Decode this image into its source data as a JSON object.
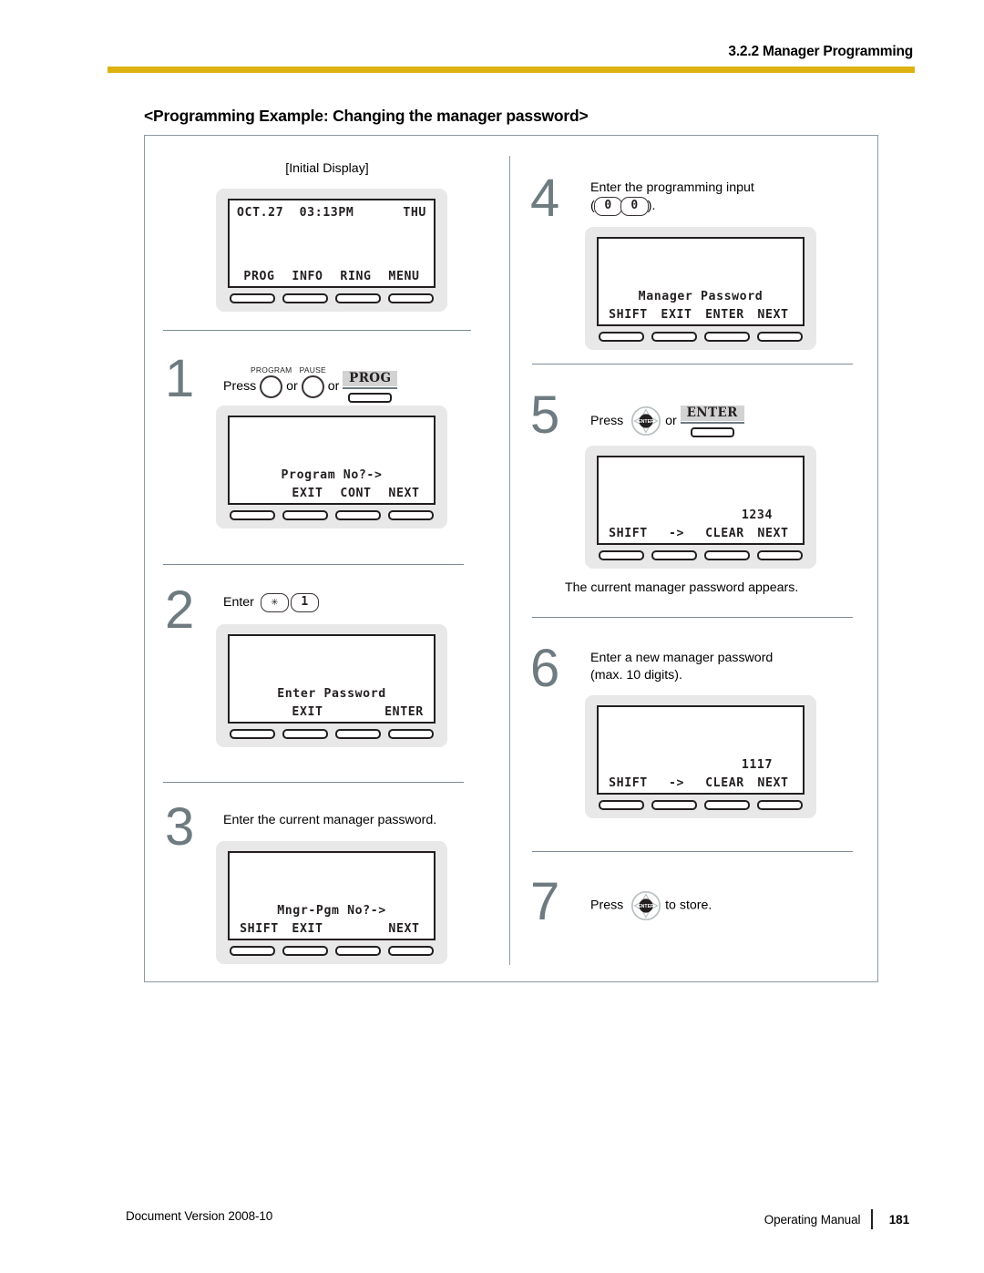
{
  "header": {
    "title": "3.2.2 Manager Programming",
    "rule_color": "#ddb211"
  },
  "section_title": "<Programming Example: Changing the manager password>",
  "initial_display": {
    "label": "[Initial Display]",
    "lcd": {
      "top_left": "OCT.27",
      "top_mid": "03:13PM",
      "top_right": "THU",
      "softkeys": [
        "PROG",
        "INFO",
        "RING",
        "MENU"
      ]
    }
  },
  "steps": [
    {
      "number": "1",
      "press_label": "Press",
      "or_1": "or",
      "or_2": "or",
      "key_program": "PROGRAM",
      "key_pause": "PAUSE",
      "key_prog": "PROG",
      "lcd": {
        "message": "Program No?->",
        "softkeys": [
          "",
          "EXIT",
          "CONT",
          "NEXT"
        ]
      }
    },
    {
      "number": "2",
      "enter_label": "Enter",
      "key_star": "✳",
      "key_one": "1",
      "lcd": {
        "message": "Enter Password",
        "softkeys": [
          "",
          "EXIT",
          "",
          "ENTER"
        ]
      }
    },
    {
      "number": "3",
      "text": "Enter the current manager  password.",
      "lcd": {
        "message": "Mngr-Pgm No?->",
        "softkeys": [
          "SHIFT",
          "EXIT",
          "",
          "NEXT"
        ]
      }
    },
    {
      "number": "4",
      "text_line1": "Enter the programming input",
      "text_paren_open": "(",
      "key_zero_a": "0",
      "key_zero_b": "0",
      "text_paren_close": ").",
      "lcd": {
        "message": "Manager Password",
        "softkeys": [
          "SHIFT",
          "EXIT",
          "ENTER",
          "NEXT"
        ]
      }
    },
    {
      "number": "5",
      "press_label": "Press",
      "or_1": "or",
      "key_navigator": "ENTER",
      "key_enter": "ENTER",
      "lcd": {
        "value": "1234",
        "softkeys": [
          "SHIFT",
          "->",
          "CLEAR",
          "NEXT"
        ]
      },
      "caption": "The current manager password appears."
    },
    {
      "number": "6",
      "text_line1": "Enter a new manager password",
      "text_line2": "(max. 10 digits).",
      "lcd": {
        "value": "1117",
        "softkeys": [
          "SHIFT",
          "->",
          "CLEAR",
          "NEXT"
        ]
      }
    },
    {
      "number": "7",
      "press_label": "Press",
      "key_navigator": "ENTER",
      "text_after": "to store."
    }
  ],
  "footer": {
    "left": "Document Version  2008-10",
    "manual": "Operating Manual",
    "page": "181"
  }
}
